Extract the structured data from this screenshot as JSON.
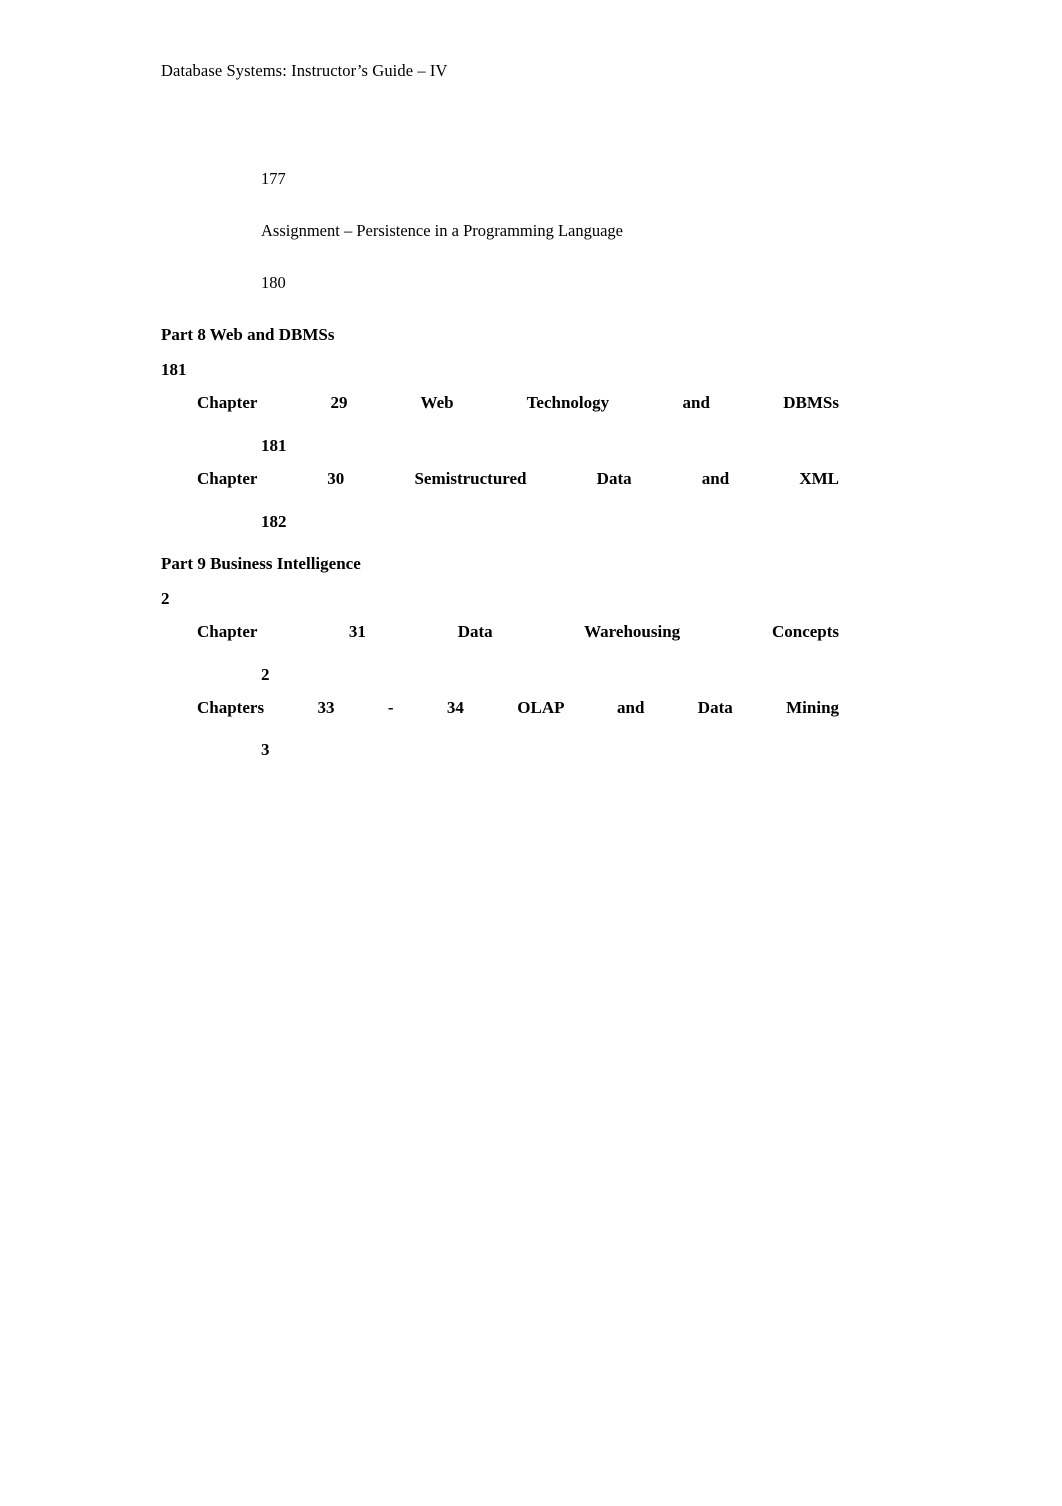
{
  "document": {
    "running_header": "Database Systems: Instructor’s Guide – IV",
    "text_color": "#000000",
    "page_background": "#ffffff"
  },
  "front_matter": {
    "page_number_top": "177",
    "assignment_entry": "Assignment – Persistence in a Programming Language",
    "page_number_after_assignment": "180"
  },
  "parts": [
    {
      "heading": "Part 8  Web and DBMSs",
      "heading_pagenum": "181",
      "chapters": [
        {
          "tokens": [
            "Chapter",
            "29",
            "Web",
            "Technology",
            "and",
            "DBMSs"
          ],
          "label": "Chapter",
          "number": "29",
          "title": "Web Technology and DBMSs",
          "pagenum": "181"
        },
        {
          "tokens": [
            "Chapter",
            "30",
            "Semistructured",
            "Data",
            "and",
            "XML"
          ],
          "label": "Chapter",
          "number": "30",
          "title": "Semistructured Data and XML",
          "pagenum": "182"
        }
      ]
    },
    {
      "heading": "Part 9  Business Intelligence",
      "heading_pagenum": "2",
      "chapters": [
        {
          "tokens": [
            "Chapter",
            "31",
            "Data",
            "Warehousing",
            "Concepts"
          ],
          "label": "Chapter",
          "number": "31",
          "title": "Data Warehousing Concepts",
          "pagenum": "2"
        },
        {
          "tokens": [
            "Chapters",
            "33",
            "-",
            "34",
            "OLAP",
            "and",
            "Data",
            "Mining"
          ],
          "label": "Chapters",
          "number": "33 - 34",
          "title": "OLAP and Data Mining",
          "pagenum": "3"
        }
      ]
    }
  ]
}
